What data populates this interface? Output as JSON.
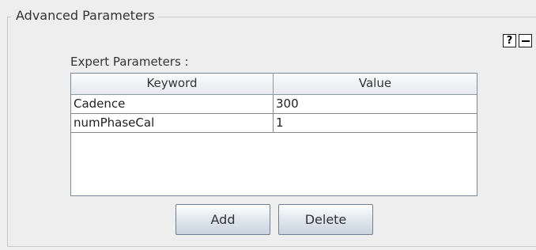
{
  "group": {
    "title": "Advanced Parameters"
  },
  "controls": {
    "help_label": "?",
    "collapse_icon": "minus-icon"
  },
  "expert": {
    "label": "Expert Parameters :",
    "columns": [
      "Keyword",
      "Value"
    ],
    "rows": [
      {
        "keyword": "Cadence",
        "value": "300"
      },
      {
        "keyword": "numPhaseCal",
        "value": "1"
      }
    ]
  },
  "buttons": {
    "add_label": "Add",
    "delete_label": "Delete"
  }
}
